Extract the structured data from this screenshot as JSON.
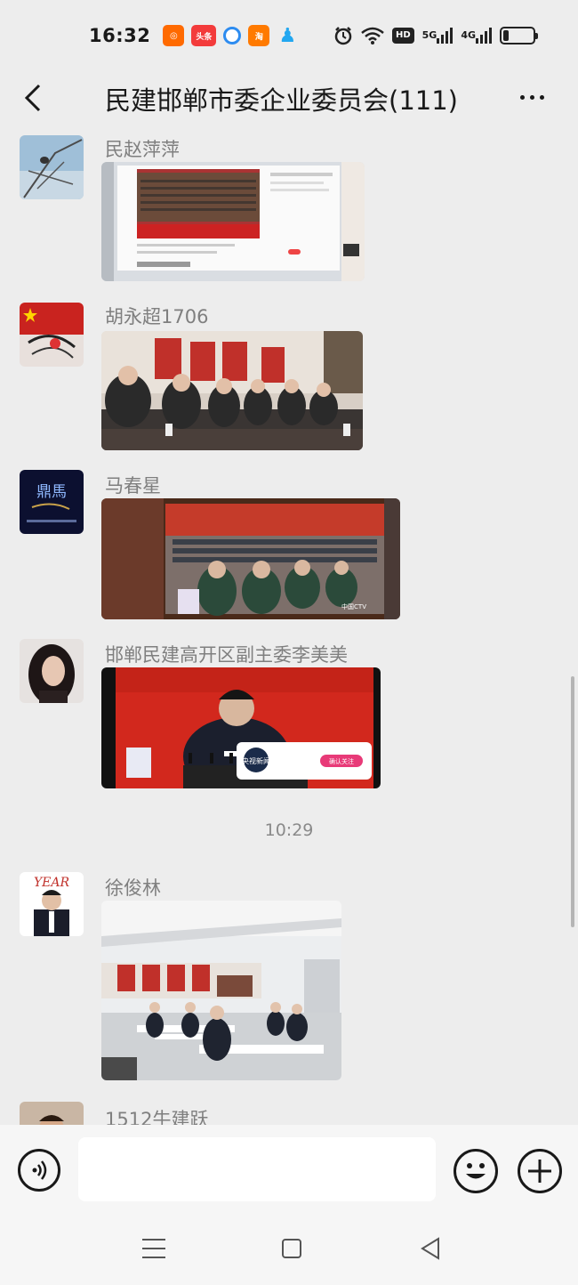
{
  "status_bar": {
    "time": "16:32",
    "app_icons": [
      "kuaishou-icon",
      "toutiao-icon",
      "circle-app-icon",
      "taobao-icon",
      "qq-icon"
    ],
    "toutiao_label": "头条",
    "hd_label": "HD",
    "signal_1": "5G",
    "signal_2": "4G",
    "battery_level": 0.2
  },
  "header": {
    "title": "民建邯郸市委企业委员会(111)"
  },
  "messages": [
    {
      "sender": "民赵萍萍",
      "type": "image",
      "image_desc": "screen-photo-congress"
    },
    {
      "sender": "胡永超1706",
      "type": "image",
      "image_desc": "meeting-room-photo"
    },
    {
      "sender": "马春星",
      "type": "image",
      "image_desc": "tv-broadcast-photo"
    },
    {
      "sender": "邯郸民建高开区副主委李美美",
      "type": "image",
      "image_desc": "speaker-broadcast-photo"
    },
    {
      "sender": "徐俊林",
      "type": "image",
      "image_desc": "conference-hall-photo"
    },
    {
      "sender": "1512牛建跃",
      "type": "image",
      "image_desc": ""
    }
  ],
  "time_divider": "10:29",
  "avatar_texts": {
    "avatar3": "鼎馬",
    "avatar5": "YEAR"
  },
  "photo_texts": {
    "tv_logo": "央视新闻",
    "follow_btn": "确认关注",
    "cctv": "中国CTV"
  },
  "input": {
    "placeholder": ""
  },
  "colors": {
    "background": "#ededed",
    "input_bar": "#f6f6f6",
    "sender_name": "#7f7f7f"
  }
}
